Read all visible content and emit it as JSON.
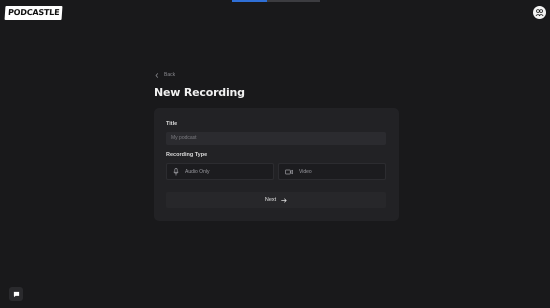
{
  "app": {
    "logo_text": "PODCASTLE"
  },
  "progress": {
    "value": 0.4,
    "color": "#2f6fd6"
  },
  "nav": {
    "back_label": "Back"
  },
  "page": {
    "title": "New Recording"
  },
  "form": {
    "title_label": "Title",
    "title_placeholder": "My podcast",
    "title_value": "",
    "type_label": "Recording Type",
    "options": [
      {
        "label": "Audio Only",
        "icon": "microphone-icon"
      },
      {
        "label": "Video",
        "icon": "video-camera-icon"
      }
    ],
    "next_label": "Next",
    "next_icon": "arrow-right-icon"
  },
  "icons": {
    "avatar": "user-group-icon",
    "chat": "chat-icon",
    "back": "chevron-left-icon"
  }
}
